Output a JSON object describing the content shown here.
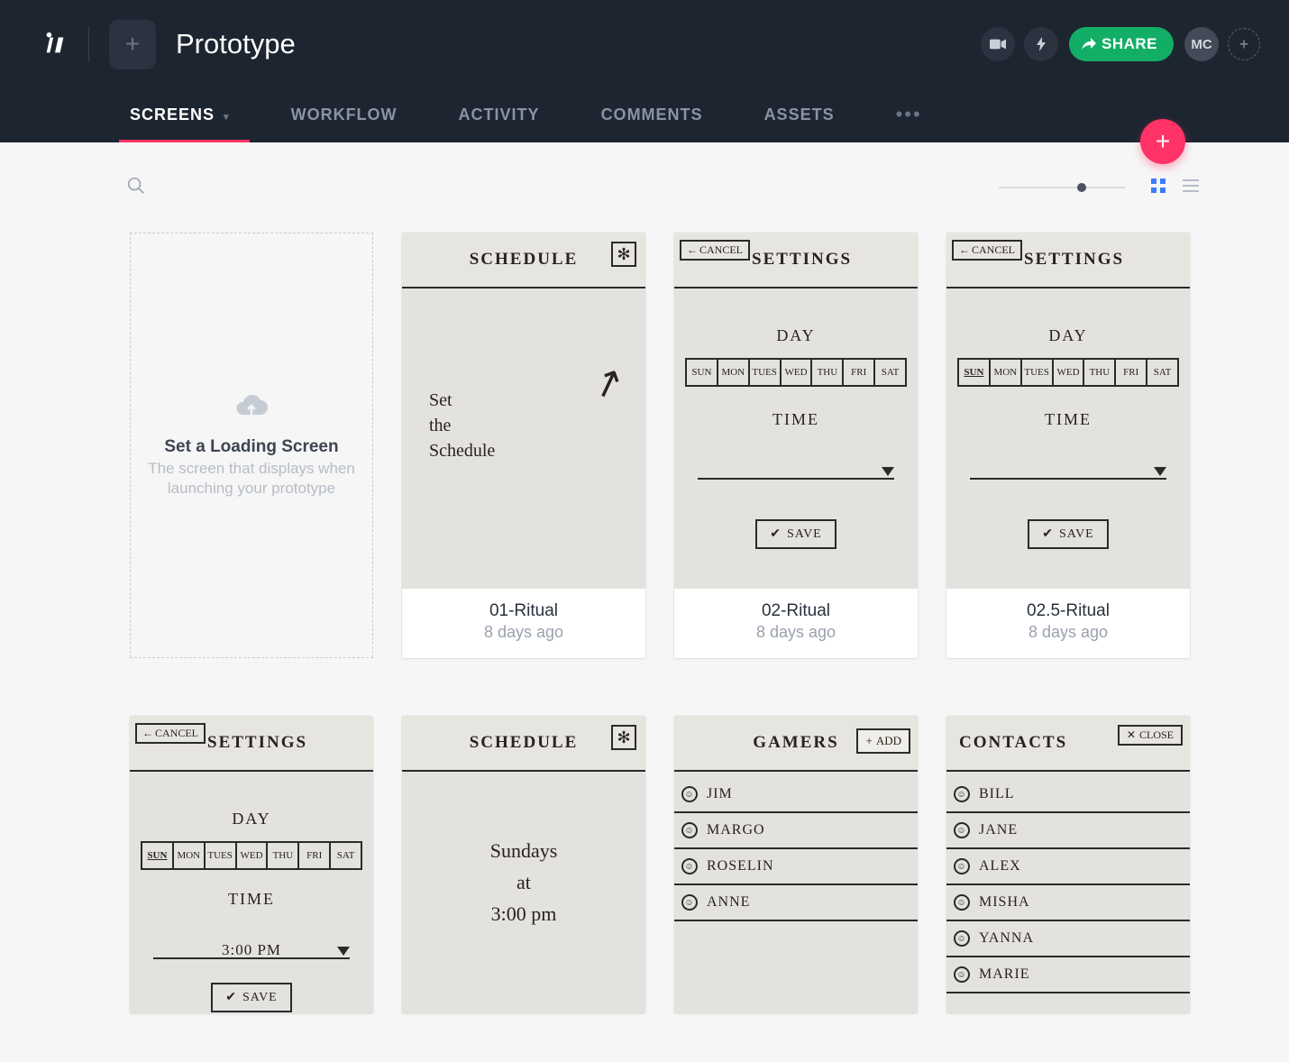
{
  "header": {
    "project_title": "Prototype",
    "share_label": "SHARE",
    "avatar_initials": "MC"
  },
  "tabs": {
    "items": [
      {
        "label": "SCREENS",
        "active": true
      },
      {
        "label": "WORKFLOW"
      },
      {
        "label": "ACTIVITY"
      },
      {
        "label": "COMMENTS"
      },
      {
        "label": "ASSETS"
      }
    ]
  },
  "loading_card": {
    "title": "Set a Loading Screen",
    "subtitle": "The screen that displays when launching your prototype"
  },
  "screens": [
    {
      "title": "01-Ritual",
      "date": "8 days ago"
    },
    {
      "title": "02-Ritual",
      "date": "8 days ago"
    },
    {
      "title": "02.5-Ritual",
      "date": "8 days ago"
    }
  ],
  "mockups": {
    "m1": {
      "header": "SCHEDULE",
      "note": "Set\nthe\nSchedule"
    },
    "m2": {
      "cancel": "CANCEL",
      "header": "SETTINGS",
      "day_label": "DAY",
      "days": [
        "SUN",
        "MON",
        "TUES",
        "WED",
        "THU",
        "FRI",
        "SAT"
      ],
      "time_label": "TIME",
      "save": "SAVE",
      "highlight": ""
    },
    "m3": {
      "cancel": "CANCEL",
      "header": "SETTINGS",
      "day_label": "DAY",
      "days": [
        "SUN",
        "MON",
        "TUES",
        "WED",
        "THU",
        "FRI",
        "SAT"
      ],
      "time_label": "TIME",
      "save": "SAVE",
      "highlight": "SUN"
    },
    "m4": {
      "cancel": "CANCEL",
      "header": "SETTINGS",
      "day_label": "DAY",
      "days": [
        "SUN",
        "MON",
        "TUES",
        "WED",
        "THU",
        "FRI",
        "SAT"
      ],
      "time_label": "TIME",
      "time_value": "3:00 PM",
      "save": "SAVE",
      "highlight": "SUN"
    },
    "m5": {
      "header": "SCHEDULE",
      "big": "Sundays\nat\n3:00 pm"
    },
    "m6": {
      "header": "GAMERS",
      "add": "ADD",
      "rows": [
        "JIM",
        "MARGO",
        "ROSELIN",
        "ANNE"
      ]
    },
    "m7": {
      "header": "CONTACTS",
      "close": "CLOSE",
      "rows": [
        "BILL",
        "JANE",
        "ALEX",
        "MISHA",
        "YANNA",
        "MARIE"
      ]
    }
  }
}
